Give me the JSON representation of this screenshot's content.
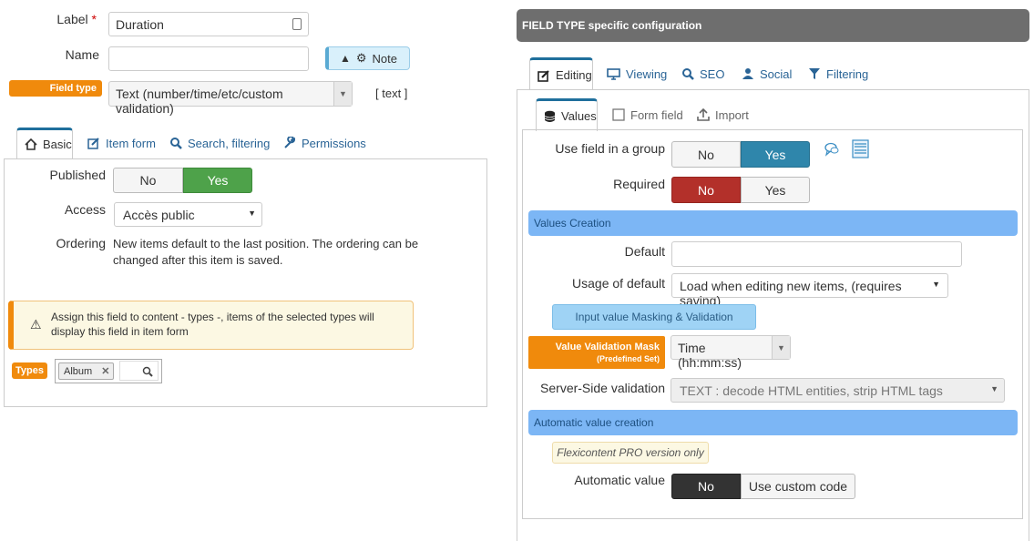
{
  "left": {
    "label_label": "Label",
    "label_required": "*",
    "label_value": "Duration",
    "name_label": "Name",
    "name_value": "",
    "note_button": "Note",
    "field_type_label": "Field type",
    "field_type_value": "Text (number/time/etc/custom validation)",
    "field_type_code": "[ text ]",
    "tabs": [
      {
        "label": "Basic",
        "icon": "home-icon"
      },
      {
        "label": "Item form",
        "icon": "edit-icon"
      },
      {
        "label": "Search, filtering",
        "icon": "search-icon"
      },
      {
        "label": "Permissions",
        "icon": "wrench-icon"
      }
    ],
    "published_label": "Published",
    "published_no": "No",
    "published_yes": "Yes",
    "access_label": "Access",
    "access_value": "Accès public",
    "ordering_label": "Ordering",
    "ordering_text": "New items default to the last position. The ordering can be changed after this item is saved.",
    "warning_text": "Assign this field to content - types -, items of the selected types will display this field in item form",
    "types_label": "Types",
    "types_tag": "Album"
  },
  "right": {
    "header": "FIELD TYPE specific configuration",
    "tabs": [
      {
        "label": "Editing",
        "icon": "edit-icon"
      },
      {
        "label": "Viewing",
        "icon": "monitor-icon"
      },
      {
        "label": "SEO",
        "icon": "search-icon"
      },
      {
        "label": "Social",
        "icon": "user-icon"
      },
      {
        "label": "Filtering",
        "icon": "filter-icon"
      }
    ],
    "subtabs": [
      {
        "label": "Values",
        "icon": "database-icon"
      },
      {
        "label": "Form field",
        "icon": "checkbox-icon"
      },
      {
        "label": "Import",
        "icon": "upload-icon"
      }
    ],
    "use_group_label": "Use field in a group",
    "use_group_no": "No",
    "use_group_yes": "Yes",
    "required_label": "Required",
    "required_no": "No",
    "required_yes": "Yes",
    "values_creation": "Values Creation",
    "default_label": "Default",
    "default_value": "",
    "usage_label": "Usage of default",
    "usage_value": "Load when editing new items, (requires saving)",
    "masking_button": "Input value Masking & Validation",
    "mask_label": "Value Validation Mask",
    "mask_sublabel": "(Predefined Set)",
    "mask_value": "Time (hh:mm:ss)",
    "server_label": "Server-Side validation",
    "server_value": "TEXT : decode HTML entities, strip HTML tags",
    "auto_creation": "Automatic value creation",
    "pro_note": "Flexicontent PRO version only",
    "auto_label": "Automatic value",
    "auto_no": "No",
    "auto_custom": "Use custom code"
  },
  "colors": {
    "accent_orange": "#f08a0c",
    "yes_green": "#4ea24a",
    "yes_blue": "#2f86ab",
    "no_red": "#b3302a",
    "section_blue": "#7cb6f5",
    "header_gray": "#6e6e6e"
  }
}
